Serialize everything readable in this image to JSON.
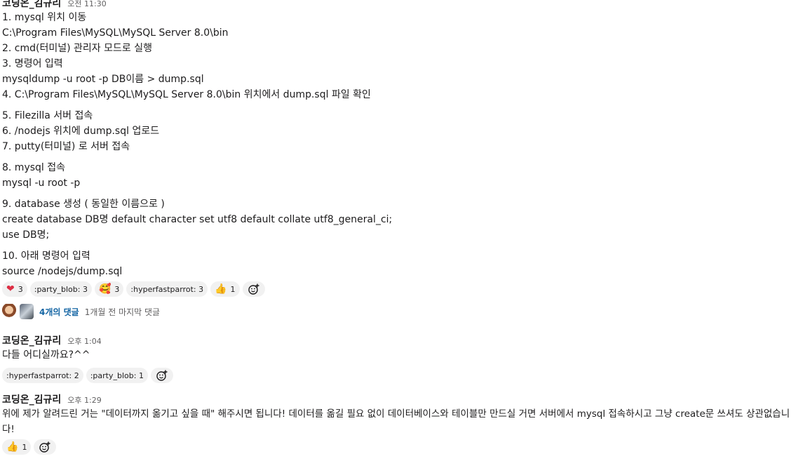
{
  "messages": [
    {
      "author": "코딩온_김규리",
      "time": "오전 11:30",
      "lines": [
        "1. mysql 위치 이동",
        "C:\\Program Files\\MySQL\\MySQL Server 8.0\\bin",
        "2. cmd(터미널) 관리자 모드로 실행",
        "3. 명령어 입력",
        "mysqldump -u root -p DB이름 > dump.sql",
        "4. C:\\Program Files\\MySQL\\MySQL Server 8.0\\bin 위치에서 dump.sql 파일 확인",
        "5. Filezilla 서버 접속",
        "6. /nodejs 위치에 dump.sql 업로드",
        "7. putty(터미널) 로 서버 접속",
        "8. mysql 접속",
        "mysql -u root -p",
        "9. database 생성 ( 동일한 이름으로 )",
        "create database DB명 default character set utf8 default collate utf8_general_ci;",
        "use DB명;",
        "10. 아래 명령어 입력",
        "source /nodejs/dump.sql"
      ],
      "reactions": [
        {
          "emoji": "❤",
          "name": "heart-emoji",
          "count": "3"
        },
        {
          "label": ":party_blob:",
          "count": "3"
        },
        {
          "emoji": "🥰",
          "name": "smiling-face-hearts-emoji",
          "count": "3"
        },
        {
          "label": ":hyperfastparrot:",
          "count": "3"
        },
        {
          "emoji": "👍",
          "name": "thumbs-up-emoji",
          "count": "1"
        }
      ],
      "thread": {
        "replies": "4개의 댓글",
        "last_reply": "1개월 전 마지막 댓글"
      }
    },
    {
      "author": "코딩온_김규리",
      "time": "오후 1:04",
      "text": "다들 어디실까요?^^",
      "reactions": [
        {
          "label": ":hyperfastparrot:",
          "count": "2"
        },
        {
          "label": ":party_blob:",
          "count": "1"
        }
      ]
    },
    {
      "author": "코딩온_김규리",
      "time": "오후 1:29",
      "text": "위에 제가 알려드린 거는 \"데이터까지 옮기고 싶을 때\" 해주시면 됩니다! 데이터를 옮길 필요 없이 데이터베이스와 테이블만 만드실 거면 서버에서 mysql 접속하시고 그냥 create문 쓰셔도 상관없습니다!",
      "reactions": [
        {
          "emoji": "👍",
          "name": "thumbs-up-emoji",
          "count": "1"
        }
      ]
    }
  ],
  "colors": {
    "text": "#1d1c1d",
    "muted": "#616061",
    "link": "#1264a3",
    "reaction_bg": "#f1f1f1"
  }
}
